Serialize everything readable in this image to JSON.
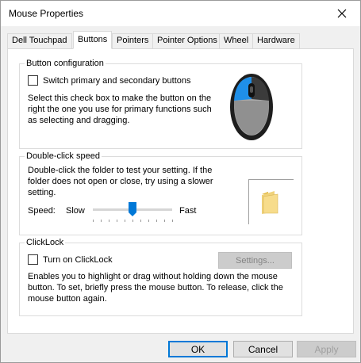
{
  "window": {
    "title": "Mouse Properties"
  },
  "tabs": [
    {
      "label": "Dell Touchpad"
    },
    {
      "label": "Buttons"
    },
    {
      "label": "Pointers"
    },
    {
      "label": "Pointer Options"
    },
    {
      "label": "Wheel"
    },
    {
      "label": "Hardware"
    }
  ],
  "active_tab": "Buttons",
  "button_config": {
    "title": "Button configuration",
    "checkbox_label": "Switch primary and secondary buttons",
    "checked": false,
    "description": "Select this check box to make the button on the right the one you use for primary functions such as selecting and dragging."
  },
  "double_click": {
    "title": "Double-click speed",
    "description": "Double-click the folder to test your setting.  If the folder does not open or close, try using a slower setting.",
    "speed_label": "Speed:",
    "slow_label": "Slow",
    "fast_label": "Fast",
    "speed_value": 0.5,
    "tick_count": 11
  },
  "clicklock": {
    "title": "ClickLock",
    "checkbox_label": "Turn on ClickLock",
    "checked": false,
    "settings_label": "Settings...",
    "description": "Enables you to highlight or drag without holding down the mouse button.  To set, briefly press the mouse button.  To release, click the mouse button again."
  },
  "footer": {
    "ok_label": "OK",
    "cancel_label": "Cancel",
    "apply_label": "Apply"
  },
  "colors": {
    "accent": "#0078d7"
  }
}
